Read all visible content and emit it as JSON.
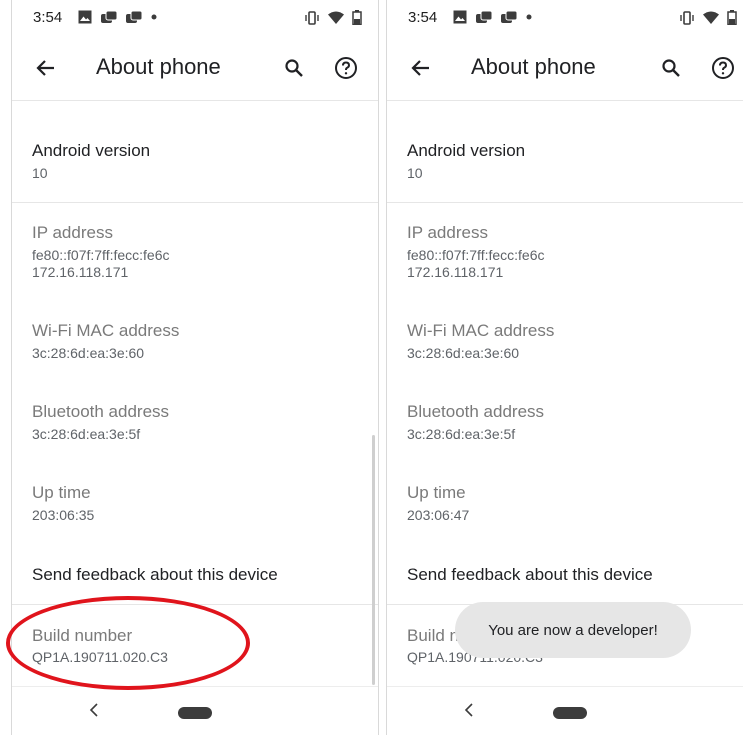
{
  "left": {
    "status_time": "3:54",
    "app_title": "About phone",
    "items": [
      {
        "title": "Android version",
        "summary": "10"
      },
      {
        "title": "IP address",
        "summary_lines": [
          "fe80::f07f:7ff:fecc:fe6c",
          "172.16.118.171"
        ]
      },
      {
        "title": "Wi-Fi MAC address",
        "summary": "3c:28:6d:ea:3e:60"
      },
      {
        "title": "Bluetooth address",
        "summary": "3c:28:6d:ea:3e:5f"
      },
      {
        "title": "Up time",
        "summary": "203:06:35"
      },
      {
        "title": "Send feedback about this device"
      },
      {
        "title": "Build number",
        "summary": "QP1A.190711.020.C3"
      }
    ]
  },
  "right": {
    "status_time": "3:54",
    "app_title": "About phone",
    "items": [
      {
        "title": "Android version",
        "summary": "10"
      },
      {
        "title": "IP address",
        "summary_lines": [
          "fe80::f07f:7ff:fecc:fe6c",
          "172.16.118.171"
        ]
      },
      {
        "title": "Wi-Fi MAC address",
        "summary": "3c:28:6d:ea:3e:60"
      },
      {
        "title": "Bluetooth address",
        "summary": "3c:28:6d:ea:3e:5f"
      },
      {
        "title": "Up time",
        "summary": "203:06:47"
      },
      {
        "title": "Send feedback about this device"
      },
      {
        "title": "Build number",
        "summary": "QP1A.190711.020.C3"
      }
    ],
    "toast": "You are now a developer!"
  },
  "icons": {
    "back": "arrow-back-icon",
    "search": "search-icon",
    "help": "help-icon",
    "nav_back": "chevron-left-icon",
    "nav_home": "home-pill"
  },
  "colors": {
    "text_primary": "#202124",
    "text_secondary": "#5f6368",
    "highlight": "#e0141c",
    "toast_bg": "#e6e6e6"
  }
}
